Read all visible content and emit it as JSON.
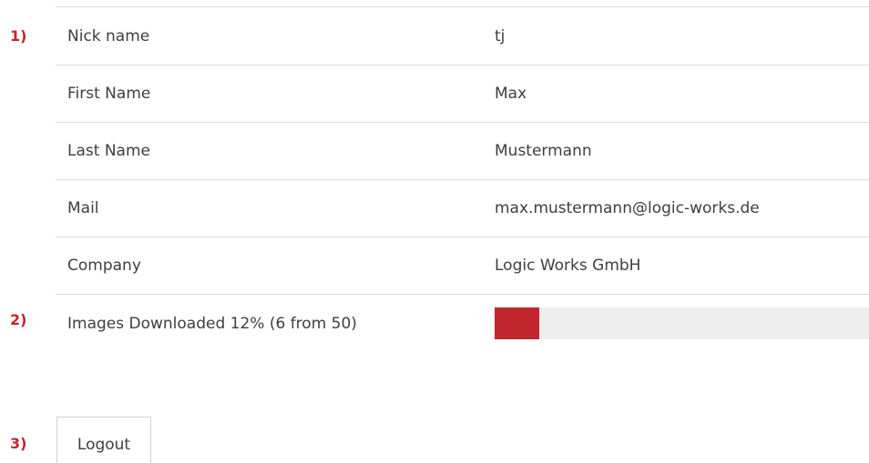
{
  "markers": {
    "first": "1)",
    "second": "2)",
    "third": "3)"
  },
  "profile": {
    "rows": [
      {
        "label": "Nick name",
        "value": "tj"
      },
      {
        "label": "First Name",
        "value": "Max"
      },
      {
        "label": "Last Name",
        "value": "Mustermann"
      },
      {
        "label": "Mail",
        "value": "max.mustermann@logic-works.de"
      },
      {
        "label": "Company",
        "value": "Logic Works GmbH"
      }
    ]
  },
  "downloads": {
    "label": "Images Downloaded 12% (6 from 50)",
    "progress_fraction": 0.12,
    "bar_color": "#c0262c",
    "track_color": "#eeeeee"
  },
  "actions": {
    "logout_label": "Logout"
  }
}
